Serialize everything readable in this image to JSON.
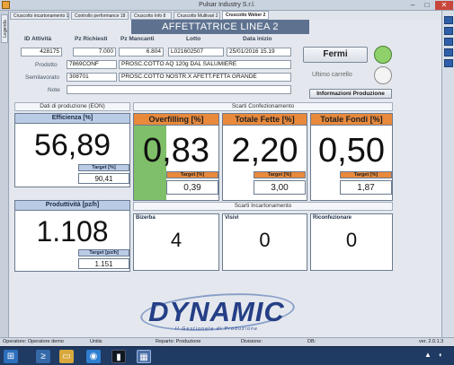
{
  "window": {
    "title": "Pulsar Industry S.r.l.",
    "min": "–",
    "max": "□",
    "close": "✕"
  },
  "left_tab": {
    "label": "Legenda"
  },
  "tabs": [
    {
      "label": "Cruscotto incartonamento 1"
    },
    {
      "label": "Controllo performance 18"
    },
    {
      "label": "Cruscotto Info 8"
    },
    {
      "label": "Cruscotto Multivari 2"
    },
    {
      "label": "Cruscotto Weber 2"
    }
  ],
  "tab_close": "x",
  "header": {
    "title": "AFFETTATRICE LINEA 2"
  },
  "order": {
    "col_id": "ID Attività",
    "col_pz_rich": "Pz Richiesti",
    "col_pz_manc": "Pz Mancanti",
    "col_lotto": "Lotto",
    "col_data": "Data inizio",
    "id": "428175",
    "pz_rich": "7.000",
    "pz_manc": "6.804",
    "lotto": "L021602507",
    "data": "25/01/2016 15.19",
    "prodotto_label": "Prodotto",
    "prodotto_code": "7869CONF",
    "prodotto_desc": "PROSC.COTTO AQ 120g DAL SALUMIERE",
    "semi_label": "Semilavorato",
    "semi_code": "308701",
    "semi_desc": "PROSC.COTTO NOSTR.X AFETT.FETTA GRANDE",
    "note_label": "Note",
    "note_value": ""
  },
  "controls": {
    "fermi_label": "Fermi",
    "ultimo_label": "Ultimo carrello",
    "info_label": "Informazioni Produzione",
    "status_color": "#8ed16a"
  },
  "sections": {
    "dati": "Dati di produzione (EON)",
    "scarti_conf": "Scarti Confezionamento",
    "scarti_inc": "Scarti Incartonamento"
  },
  "kpis": {
    "efficienza": {
      "title": "Efficienza [%]",
      "value": "56,89",
      "target_label": "Target [%]",
      "target": "90,41"
    },
    "overfilling": {
      "title": "Overfilling [%]",
      "value": "0,83",
      "target_label": "Target [%]",
      "target": "0,39"
    },
    "fette": {
      "title": "Totale Fette [%]",
      "value": "2,20",
      "target_label": "Target [%]",
      "target": "3,00"
    },
    "fondi": {
      "title": "Totale Fondi [%]",
      "value": "0,50",
      "target_label": "Target [%]",
      "target": "1,87"
    },
    "produttivita": {
      "title": "Produttività [pz/h]",
      "value": "1.108",
      "target_label": "Target [pz/h]",
      "target": "1.151"
    }
  },
  "counters": [
    {
      "label": "Bizerba",
      "value": "4"
    },
    {
      "label": "Visivi",
      "value": "0"
    },
    {
      "label": "Riconfezionare",
      "value": "0"
    }
  ],
  "logo": {
    "text": "DYNAMIC",
    "subtitle": "Il Gestionale di Produzione"
  },
  "statusbar": {
    "operatore": "Operatore: Operatore demo",
    "unita": "Unità:",
    "reparto": "Reparto: Produzione",
    "divisione": "Divisione:",
    "db": "DB:",
    "version": "ver. 2.0.1.3"
  },
  "taskbar": {
    "start_icon": "windows-start-icon"
  },
  "colors": {
    "accent": "#5e7290",
    "kpi_header": "#b9cbe5",
    "orange": "#e8893c",
    "green": "#7fbf6a"
  }
}
